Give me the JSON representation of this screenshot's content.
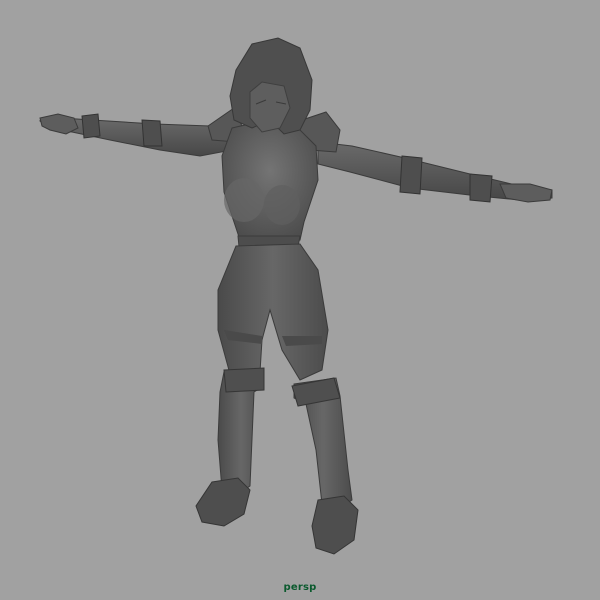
{
  "viewport": {
    "camera_name": "persp",
    "camera_label_color": "#0b5a2e",
    "background_color": "#a1a1a1",
    "shading": "smooth-shaded-gray",
    "model_color": "#5a5a5a",
    "model_pose": "t-pose"
  }
}
